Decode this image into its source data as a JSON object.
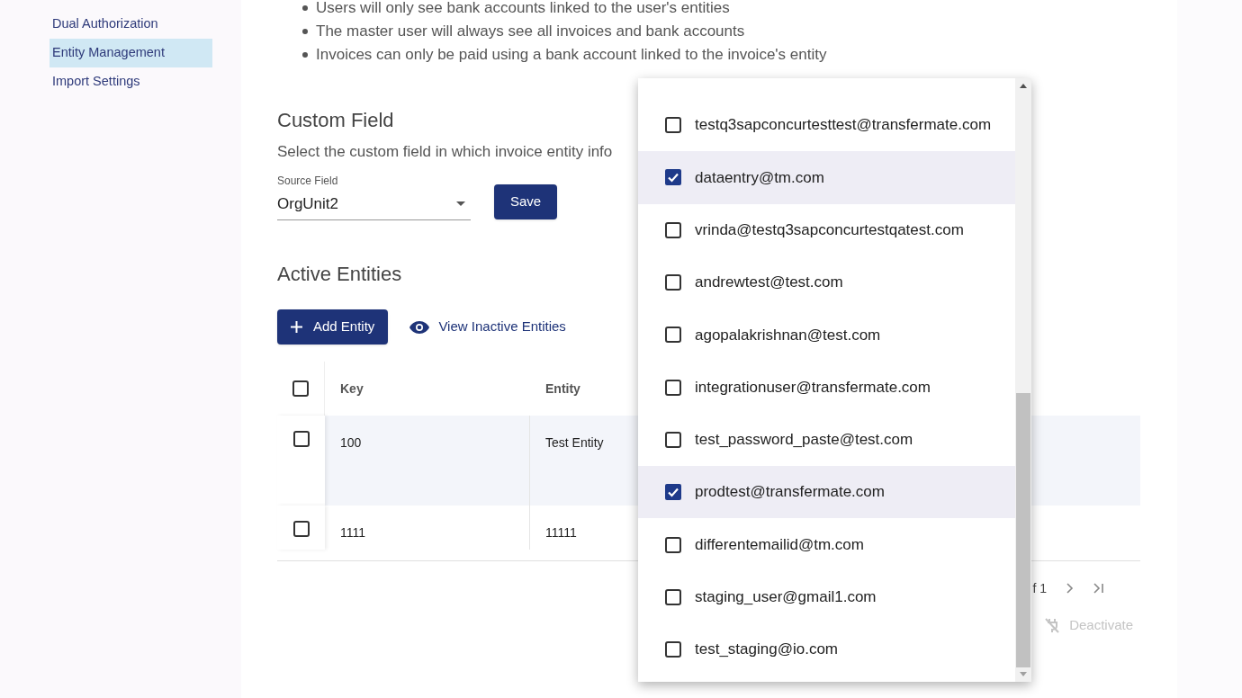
{
  "sidebar": {
    "items": [
      {
        "label": "Dual Authorization",
        "selected": false
      },
      {
        "label": "Entity Management",
        "selected": true
      },
      {
        "label": "Import Settings",
        "selected": false
      }
    ]
  },
  "notes": [
    "Users will only see bank accounts linked to the user's entities",
    "The master user will always see all invoices and bank accounts",
    "Invoices can only be paid using a bank account linked to the invoice's entity"
  ],
  "custom_field": {
    "title": "Custom Field",
    "description": "Select the custom field in which invoice entity info",
    "source_field": {
      "label": "Source Field",
      "value": "OrgUnit2"
    },
    "save_button": "Save"
  },
  "active_entities": {
    "title": "Active Entities",
    "add_button": "Add Entity",
    "view_inactive": "View Inactive Entities",
    "table": {
      "header_checked": false,
      "columns": [
        "Key",
        "Entity"
      ],
      "rows": [
        {
          "checked": false,
          "highlighted": true,
          "cells": [
            "100",
            "Test Entity"
          ]
        },
        {
          "checked": false,
          "highlighted": false,
          "cells": [
            "1111",
            "11111"
          ]
        }
      ]
    },
    "pagination": {
      "page_text": "f 1"
    },
    "deactivate_button": {
      "label": "Deactivate",
      "disabled": true
    }
  },
  "user_dropdown": {
    "options": [
      {
        "label": "testq3sapconcurtesttest@transfermate.com",
        "checked": false
      },
      {
        "label": "dataentry@tm.com",
        "checked": true
      },
      {
        "label": "vrinda@testq3sapconcurtestqatest.com",
        "checked": false
      },
      {
        "label": "andrewtest@test.com",
        "checked": false
      },
      {
        "label": "agopalakrishnan@test.com",
        "checked": false
      },
      {
        "label": "integrationuser@transfermate.com",
        "checked": false
      },
      {
        "label": "test_password_paste@test.com",
        "checked": false
      },
      {
        "label": "prodtest@transfermate.com",
        "checked": true
      },
      {
        "label": "differentemailid@tm.com",
        "checked": false
      },
      {
        "label": "staging_user@gmail1.com",
        "checked": false
      },
      {
        "label": "test_staging@io.com",
        "checked": false
      }
    ]
  }
}
